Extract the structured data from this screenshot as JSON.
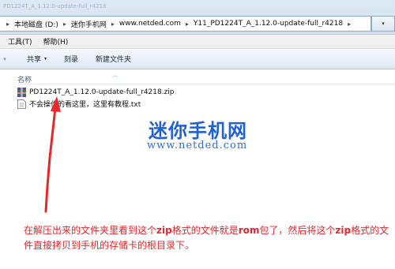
{
  "window": {
    "ghost_title": "PD1224T_A_1.12.0-update-full_r4218"
  },
  "address_bar": {
    "crumbs": [
      "本地磁盘 (D:)",
      "迷你手机网",
      "www.netded.com",
      "Y11_PD1224T_A_1.12.0-update-full_r4218"
    ],
    "chevron": "▸",
    "dropdown_glyph": "▾"
  },
  "menu": {
    "items": [
      "工具(T)",
      "帮助(H)"
    ]
  },
  "toolbar": {
    "share_label": "共享",
    "burn_label": "刻录",
    "new_folder_label": "新建文件夹",
    "dropdown_glyph": "▾",
    "edge_glyph": "▾"
  },
  "file_list": {
    "column_name": "名称",
    "sort_glyph": "︿",
    "files": [
      {
        "name": "PD1224T_A_1.12.0-update-full_r4218.zip",
        "icon": "zip-archive-icon"
      },
      {
        "name": "不会操作的看这里，这里有教程.txt",
        "icon": "text-document-icon"
      }
    ]
  },
  "watermark": {
    "site_name": "迷你手机网",
    "site_url": "www.netded.com"
  },
  "annotation": {
    "line1_part1": "在解压出来的文件夹里看到这个",
    "line1_zip": "zip",
    "line1_part2": "格式的文件就是",
    "line1_rom": "rom",
    "line1_part3": "包了，然后将这",
    "line2_part1": "个",
    "line2_zip": "zip",
    "line2_part2": "格式的文件直接拷贝到手机的存储卡的根目录下。",
    "color": "#e8262b"
  },
  "colors": {
    "watermark_blue": "#1f62d6",
    "annotation_red": "#e8262b",
    "toolbar_blue": "#dde8f5"
  }
}
